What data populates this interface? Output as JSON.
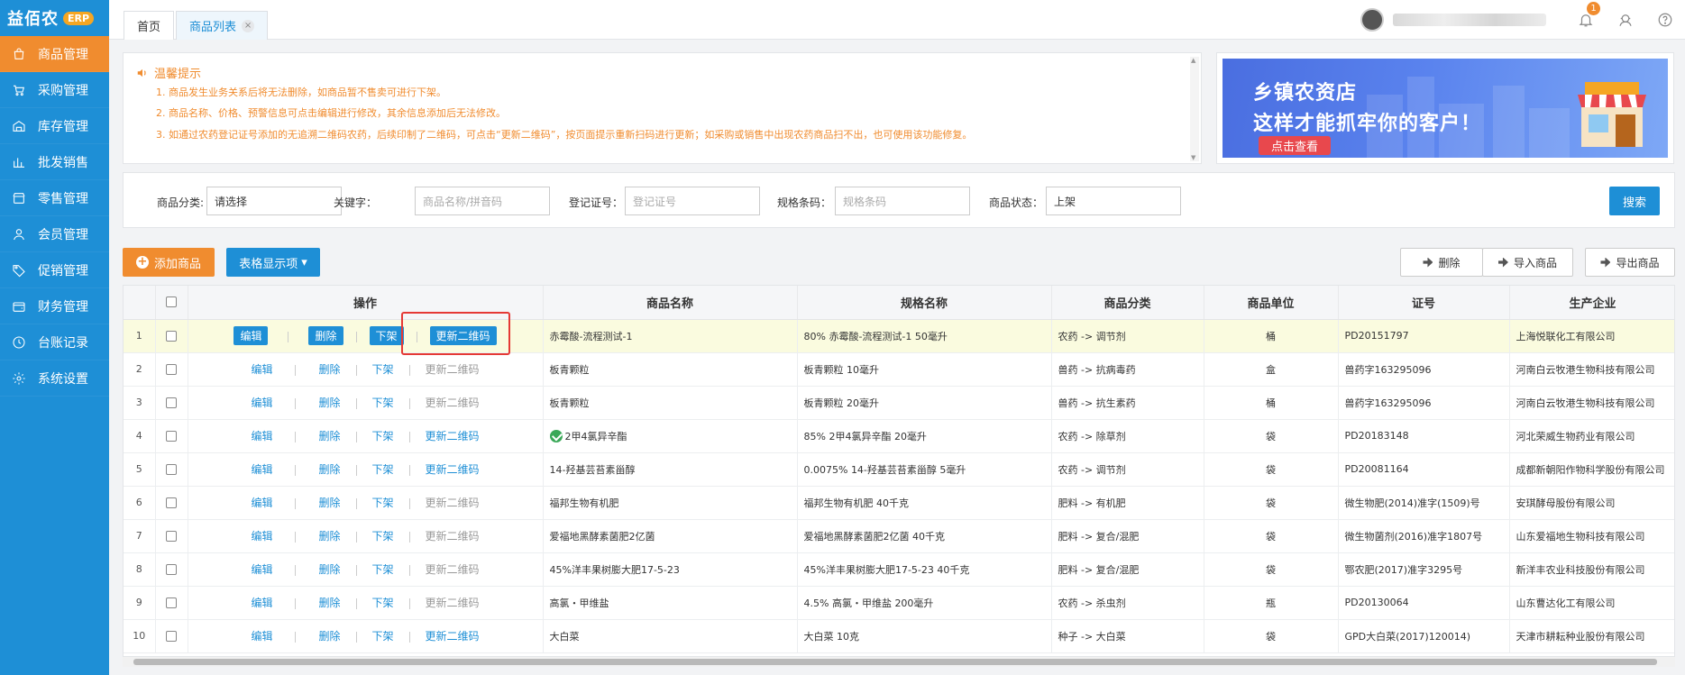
{
  "app": {
    "logo_text": "益佰农",
    "logo_badge": "ERP"
  },
  "sidebar": {
    "items": [
      {
        "label": "商品管理",
        "icon": "bag-icon",
        "active": true
      },
      {
        "label": "采购管理",
        "icon": "cart-icon"
      },
      {
        "label": "库存管理",
        "icon": "warehouse-icon"
      },
      {
        "label": "批发销售",
        "icon": "chart-icon"
      },
      {
        "label": "零售管理",
        "icon": "store-icon"
      },
      {
        "label": "会员管理",
        "icon": "user-icon"
      },
      {
        "label": "促销管理",
        "icon": "tag-icon"
      },
      {
        "label": "财务管理",
        "icon": "wallet-icon"
      },
      {
        "label": "台账记录",
        "icon": "clock-icon"
      },
      {
        "label": "系统设置",
        "icon": "gear-icon"
      }
    ]
  },
  "tabs": [
    {
      "label": "首页"
    },
    {
      "label": "商品列表",
      "active": true,
      "close": "×"
    }
  ],
  "header": {
    "bell_count": "1"
  },
  "notice": {
    "title": "温馨提示",
    "lines": [
      "1. 商品发生业务关系后将无法删除，如商品暂不售卖可进行下架。",
      "2. 商品名称、价格、预警信息可点击编辑进行修改，其余信息添加后无法修改。",
      "3. 如通过农药登记证号添加的无追溯二维码农药，后续印制了二维码，可点击“更新二维码”，按页面提示重新扫码进行更新；如采购或销售中出现农药商品扫不出，也可使用该功能修复。"
    ]
  },
  "banner": {
    "line1": "乡镇农资店",
    "line2": "这样才能抓牢你的客户！",
    "button": "点击查看"
  },
  "filter": {
    "category_label": "商品分类:",
    "category_value": "请选择",
    "keyword_label": "关键字：",
    "keyword_placeholder": "商品名称/拼音码",
    "reg_label": "登记证号：",
    "reg_placeholder": "登记证号",
    "barcode_label": "规格条码：",
    "barcode_placeholder": "规格条码",
    "status_label": "商品状态：",
    "status_value": "上架",
    "search_button": "搜索"
  },
  "toolbar": {
    "add_label": "添加商品",
    "columns_label": "表格显示项",
    "delete_label": "删除",
    "import_label": "导入商品",
    "export_label": "导出商品"
  },
  "table": {
    "headers": {
      "ops": "操作",
      "name": "商品名称",
      "spec": "规格名称",
      "category": "商品分类",
      "unit": "商品单位",
      "cert": "证号",
      "maker": "生产企业"
    },
    "op_labels": {
      "edit": "编辑",
      "delete": "删除",
      "offshelf": "下架",
      "update_qr": "更新二维码"
    },
    "rows": [
      {
        "idx": "1",
        "name": "赤霉酸-流程测试-1",
        "spec": "80% 赤霉酸-流程测试-1 50毫升",
        "category": "农药 -> 调节剂",
        "unit": "桶",
        "cert": "PD20151797",
        "maker": "上海悦联化工有限公司",
        "qr_active": true
      },
      {
        "idx": "2",
        "name": "板青颗粒",
        "spec": "板青颗粒 10毫升",
        "category": "兽药 -> 抗病毒药",
        "unit": "盒",
        "cert": "兽药字163295096",
        "maker": "河南白云牧港生物科技有限公司",
        "qr_active": false
      },
      {
        "idx": "3",
        "name": "板青颗粒",
        "spec": "板青颗粒 20毫升",
        "category": "兽药 -> 抗生素药",
        "unit": "桶",
        "cert": "兽药字163295096",
        "maker": "河南白云牧港生物科技有限公司",
        "qr_active": false
      },
      {
        "idx": "4",
        "name": "2甲4氯异辛酯",
        "spec": "85% 2甲4氯异辛酯 20毫升",
        "category": "农药 -> 除草剂",
        "unit": "袋",
        "cert": "PD20183148",
        "maker": "河北荣威生物药业有限公司",
        "qr_active": true
      },
      {
        "idx": "5",
        "name": "14-羟基芸苔素甾醇",
        "spec": "0.0075% 14-羟基芸苔素甾醇 5毫升",
        "category": "农药 -> 调节剂",
        "unit": "袋",
        "cert": "PD20081164",
        "maker": "成都新朝阳作物科学股份有限公司",
        "qr_active": true
      },
      {
        "idx": "6",
        "name": "福邦生物有机肥",
        "spec": "福邦生物有机肥 40千克",
        "category": "肥料 -> 有机肥",
        "unit": "袋",
        "cert": "微生物肥(2014)准字(1509)号",
        "maker": "安琪酵母股份有限公司",
        "qr_active": false
      },
      {
        "idx": "7",
        "name": "爱福地黑酵素菌肥2亿菌",
        "spec": "爱福地黑酵素菌肥2亿菌 40千克",
        "category": "肥料 -> 复合/混肥",
        "unit": "袋",
        "cert": "微生物菌剂(2016)准字1807号",
        "maker": "山东爱福地生物科技有限公司",
        "qr_active": false
      },
      {
        "idx": "8",
        "name": "45%洋丰果树膨大肥17-5-23",
        "spec": "45%洋丰果树膨大肥17-5-23 40千克",
        "category": "肥料 -> 复合/混肥",
        "unit": "袋",
        "cert": "鄂农肥(2017)准字3295号",
        "maker": "新洋丰农业科技股份有限公司",
        "qr_active": false
      },
      {
        "idx": "9",
        "name": "高氯・甲维盐",
        "spec": "4.5% 高氯・甲维盐 200毫升",
        "category": "农药 -> 杀虫剂",
        "unit": "瓶",
        "cert": "PD20130064",
        "maker": "山东曹达化工有限公司",
        "qr_active": false
      },
      {
        "idx": "10",
        "name": "大白菜",
        "spec": "大白菜 10克",
        "category": "种子 -> 大白菜",
        "unit": "袋",
        "cert": "GPD大白菜(2017)120014)",
        "maker": "天津市耕耘种业股份有限公司",
        "qr_active": true
      }
    ]
  }
}
